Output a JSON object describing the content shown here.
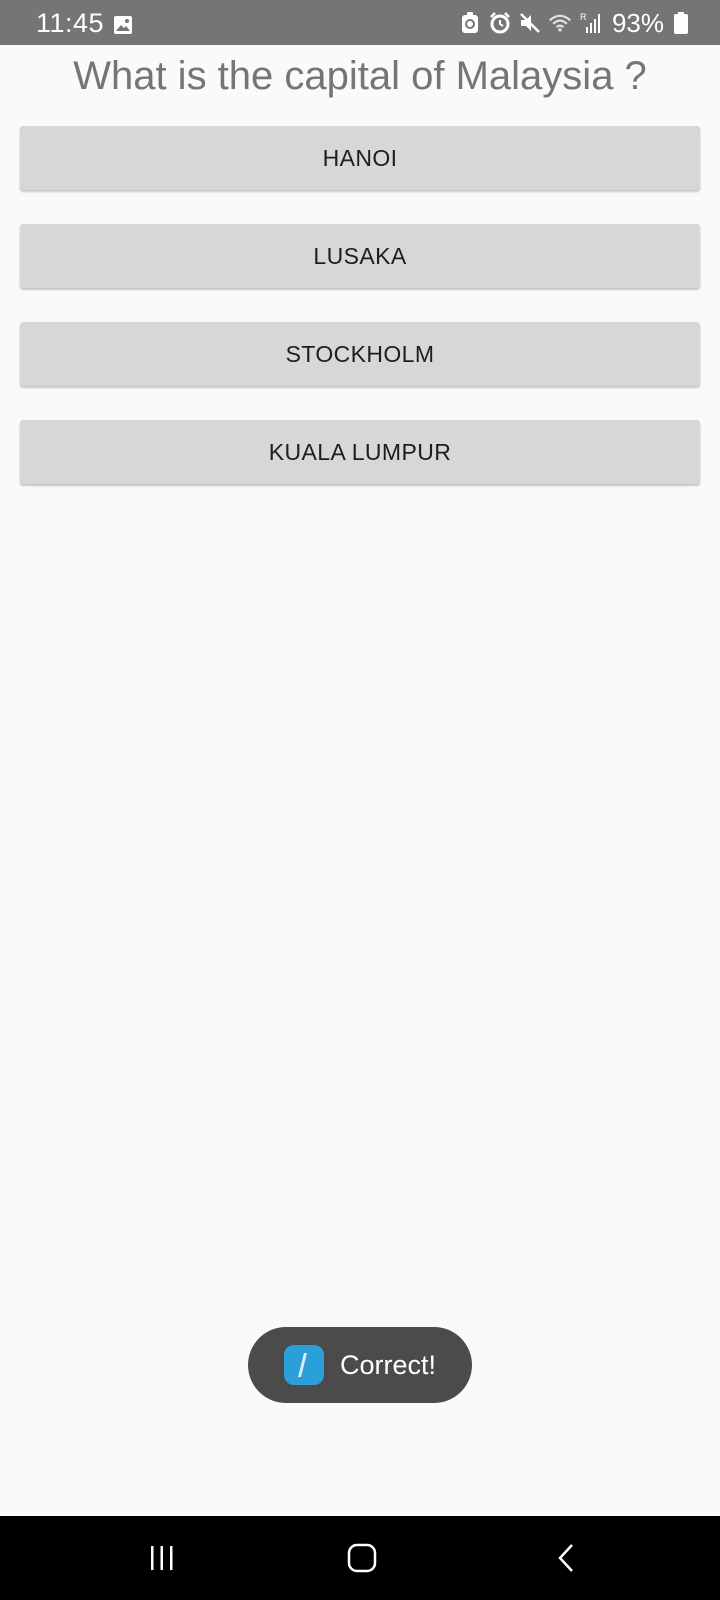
{
  "status_bar": {
    "time": "11:45",
    "battery": "93%",
    "icons": [
      "gallery-icon",
      "vpn-icon",
      "alarm-icon",
      "mute-icon",
      "wifi-icon",
      "signal-icon",
      "battery-icon"
    ]
  },
  "quiz": {
    "question": "What is the capital of Malaysia ?",
    "answers": [
      {
        "label": "HANOI"
      },
      {
        "label": "LUSAKA"
      },
      {
        "label": "STOCKHOLM"
      },
      {
        "label": "KUALA LUMPUR"
      }
    ]
  },
  "toast": {
    "text": "Correct!",
    "icon": "app-logo-icon"
  },
  "nav_bar": {
    "icons": [
      "recents-icon",
      "home-icon",
      "back-icon"
    ]
  },
  "colors": {
    "status_bar_bg": "#757575",
    "button_bg": "#d6d7d7",
    "question_text": "#757575",
    "toast_bg": "#4b4b4b",
    "nav_bar_bg": "#000000"
  }
}
